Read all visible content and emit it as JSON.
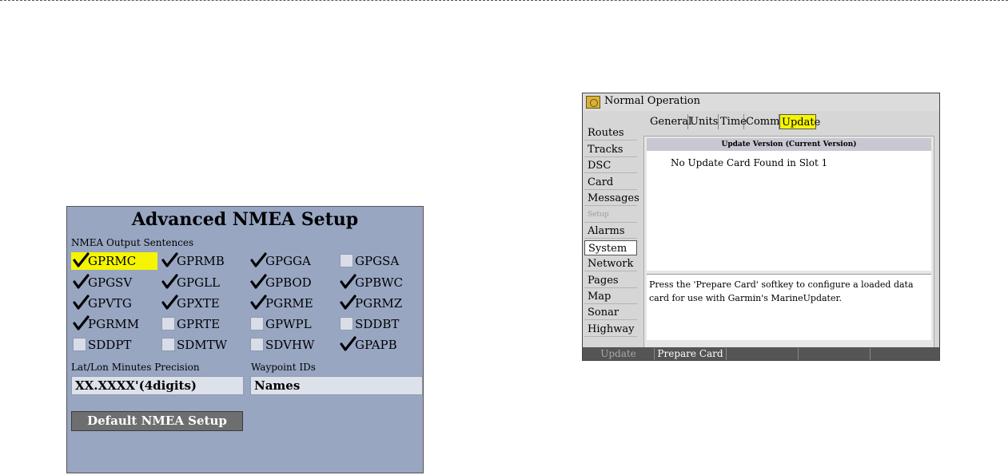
{
  "nmea": {
    "title": "Advanced NMEA Setup",
    "section_label": "NMEA Output Sentences",
    "sentences": [
      {
        "label": "GPRMC",
        "checked": true,
        "selected": true
      },
      {
        "label": "GPRMB",
        "checked": true
      },
      {
        "label": "GPGGA",
        "checked": true
      },
      {
        "label": "GPGSA",
        "checked": false
      },
      {
        "label": "GPGSV",
        "checked": true
      },
      {
        "label": "GPGLL",
        "checked": true
      },
      {
        "label": "GPBOD",
        "checked": true
      },
      {
        "label": "GPBWC",
        "checked": true
      },
      {
        "label": "GPVTG",
        "checked": true
      },
      {
        "label": "GPXTE",
        "checked": true
      },
      {
        "label": "PGRME",
        "checked": true
      },
      {
        "label": "PGRMZ",
        "checked": true
      },
      {
        "label": "PGRMM",
        "checked": true
      },
      {
        "label": "GPRTE",
        "checked": false
      },
      {
        "label": "GPWPL",
        "checked": false
      },
      {
        "label": "SDDBT",
        "checked": false
      },
      {
        "label": "SDDPT",
        "checked": false
      },
      {
        "label": "SDMTW",
        "checked": false
      },
      {
        "label": "SDVHW",
        "checked": false
      },
      {
        "label": "GPAPB",
        "checked": true
      }
    ],
    "precision_label": "Lat/Lon Minutes Precision",
    "precision_value": "XX.XXXX'(4digits)",
    "waypoint_label": "Waypoint IDs",
    "waypoint_value": "Names",
    "default_button": "Default NMEA Setup",
    "colors": {
      "panel": "#98a6c2",
      "highlight": "#f5f500"
    }
  },
  "garmin": {
    "title": "Normal Operation",
    "sidebar": [
      {
        "label": "Routes"
      },
      {
        "label": "Tracks"
      },
      {
        "label": "DSC"
      },
      {
        "label": "Card"
      },
      {
        "label": "Messages"
      },
      {
        "label": "Setup",
        "muted": true
      },
      {
        "label": "Alarms"
      },
      {
        "label": "System",
        "selected": true
      },
      {
        "label": "Network"
      },
      {
        "label": "Pages"
      },
      {
        "label": "Map"
      },
      {
        "label": "Sonar"
      },
      {
        "label": "Highway"
      }
    ],
    "tabs": [
      {
        "label": "General"
      },
      {
        "label": "Units"
      },
      {
        "label": "Time"
      },
      {
        "label": "Comm"
      },
      {
        "label": "Update",
        "active": true
      }
    ],
    "update_header": "Update Version (Current Version)",
    "update_message": "No Update Card Found in Slot 1",
    "info_text": "Press the 'Prepare Card' softkey to configure a loaded data card for use with Garmin's MarineUpdater.",
    "softkeys": [
      {
        "label": "Update",
        "disabled": true
      },
      {
        "label": "Prepare Card"
      },
      {
        "label": ""
      },
      {
        "label": ""
      },
      {
        "label": ""
      }
    ]
  }
}
